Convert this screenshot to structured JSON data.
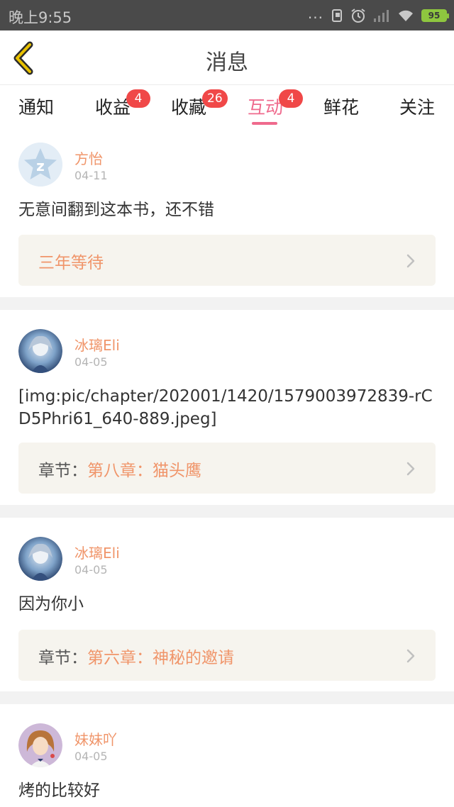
{
  "status_bar": {
    "time": "晚上9:55",
    "dots": "...",
    "battery": "95",
    "icons": [
      "sim-icon",
      "alarm-icon",
      "signal-icon",
      "wifi-icon",
      "battery-icon"
    ]
  },
  "header": {
    "title": "消息",
    "back_icon": "chevron-left-icon",
    "accent_color": "#e8c100"
  },
  "tabs": [
    {
      "label": "通知",
      "badge": ""
    },
    {
      "label": "收益",
      "badge": "4"
    },
    {
      "label": "收藏",
      "badge": "26"
    },
    {
      "label": "互动",
      "badge": "4",
      "active": true
    },
    {
      "label": "鲜花",
      "badge": ""
    },
    {
      "label": "关注",
      "badge": ""
    }
  ],
  "colors": {
    "active_tab": "#ef6a8d",
    "username": "#f0956a",
    "badge": "#f04848",
    "ref_bg": "#f6f4ee"
  },
  "messages": [
    {
      "user": "方怡",
      "date": "04-11",
      "avatar": "default-star-avatar",
      "content": "无意间翻到这本书，还不错",
      "ref_prefix": "",
      "ref_title": "三年等待"
    },
    {
      "user": "冰璃Eli",
      "date": "04-05",
      "avatar": "anime-girl-avatar",
      "content": "[img:pic/chapter/202001/1420/1579003972839-rCD5Phri61_640-889.jpeg]",
      "ref_prefix": "章节：",
      "ref_title": "第八章：猫头鹰"
    },
    {
      "user": "冰璃Eli",
      "date": "04-05",
      "avatar": "anime-girl-avatar",
      "content": "因为你小",
      "ref_prefix": "章节：",
      "ref_title": "第六章：神秘的邀请"
    },
    {
      "user": "妹妹吖",
      "date": "04-05",
      "avatar": "girl-portrait-avatar",
      "content": "烤的比较好"
    }
  ]
}
